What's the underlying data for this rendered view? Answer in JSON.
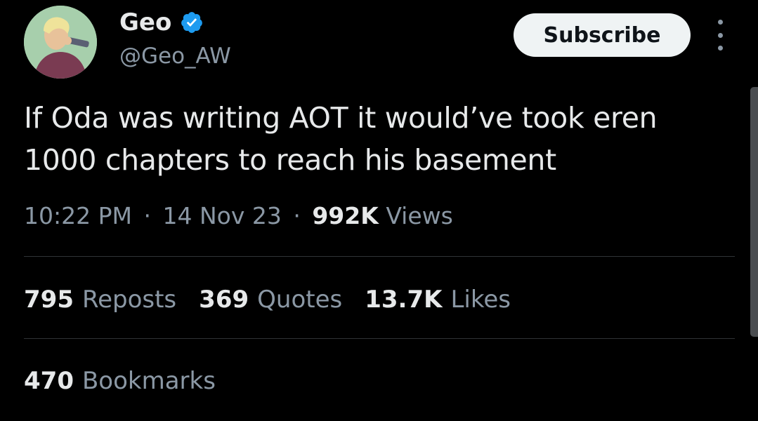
{
  "author": {
    "display_name": "Geo",
    "handle": "@Geo_AW",
    "verified": true,
    "avatar_icon": "avatar-image"
  },
  "actions": {
    "subscribe_label": "Subscribe",
    "more_icon": "more-vertical-icon"
  },
  "tweet": {
    "text_line1": "If Oda was writing AOT it would’ve took eren",
    "text_line2": "1000 chapters to reach his basement",
    "time": "10:22 PM",
    "date": "14 Nov 23",
    "separator": "·",
    "views_count": "992K",
    "views_label": "Views"
  },
  "stats": {
    "reposts_count": "795",
    "reposts_label": "Reposts",
    "quotes_count": "369",
    "quotes_label": "Quotes",
    "likes_count": "13.7K",
    "likes_label": "Likes",
    "bookmarks_count": "470",
    "bookmarks_label": "Bookmarks"
  },
  "colors": {
    "background": "#000000",
    "primary_text": "#e7e9ea",
    "secondary_text": "#8b98a5",
    "verified_blue": "#1d9bf0",
    "button_bg": "#eff3f4",
    "divider": "#2f3336"
  }
}
